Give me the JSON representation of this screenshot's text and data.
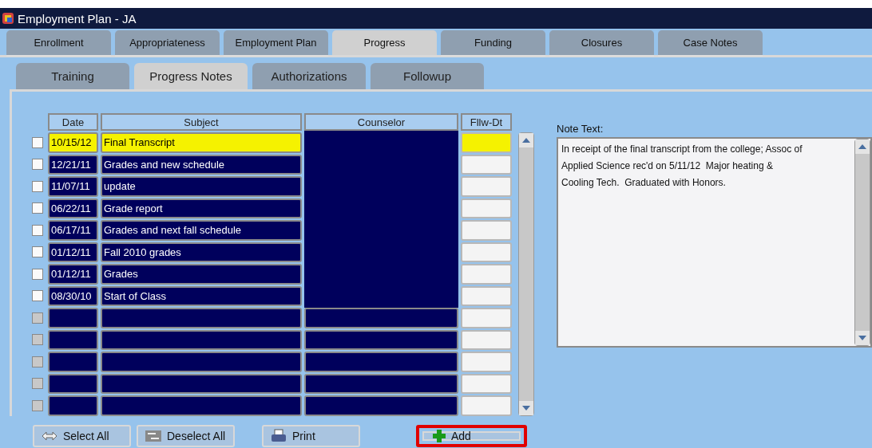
{
  "window": {
    "title": "Employment Plan - JA"
  },
  "tabs": [
    {
      "label": "Enrollment",
      "selected": false
    },
    {
      "label": "Appropriateness",
      "selected": false
    },
    {
      "label": "Employment Plan",
      "selected": false
    },
    {
      "label": "Progress",
      "selected": true
    },
    {
      "label": "Funding",
      "selected": false
    },
    {
      "label": "Closures",
      "selected": false
    },
    {
      "label": "Case Notes",
      "selected": false
    }
  ],
  "subtabs": [
    {
      "label": "Training",
      "selected": false
    },
    {
      "label": "Progress Notes",
      "selected": true
    },
    {
      "label": "Authorizations",
      "selected": false
    },
    {
      "label": "Followup",
      "selected": false
    }
  ],
  "table": {
    "columns": [
      "Date",
      "Subject",
      "Counselor",
      "Fllw-Dt"
    ],
    "rows": [
      {
        "kind": "note",
        "date": "10/15/12",
        "subject": "Final Transcript",
        "selected": true,
        "checked": false
      },
      {
        "kind": "note",
        "date": "12/21/11",
        "subject": "Grades and new schedule",
        "selected": false,
        "checked": false
      },
      {
        "kind": "note",
        "date": "11/07/11",
        "subject": "update",
        "selected": false,
        "checked": false
      },
      {
        "kind": "note",
        "date": "06/22/11",
        "subject": "Grade report",
        "selected": false,
        "checked": false
      },
      {
        "kind": "note",
        "date": "06/17/11",
        "subject": "Grades and next fall schedule",
        "selected": false,
        "checked": false
      },
      {
        "kind": "note",
        "date": "01/12/11",
        "subject": "Fall 2010 grades",
        "selected": false,
        "checked": false
      },
      {
        "kind": "note",
        "date": "01/12/11",
        "subject": "Grades",
        "selected": false,
        "checked": false
      },
      {
        "kind": "note",
        "date": "08/30/10",
        "subject": "Start of Class",
        "selected": false,
        "checked": false
      },
      {
        "kind": "empty",
        "disabled": true
      },
      {
        "kind": "empty",
        "disabled": true
      },
      {
        "kind": "empty",
        "disabled": true
      },
      {
        "kind": "empty",
        "disabled": true
      },
      {
        "kind": "empty",
        "disabled": true
      }
    ]
  },
  "note": {
    "label": "Note Text:",
    "value": "In receipt of the final transcript from the college; Assoc of Applied Science rec'd on 5/11/12  Major heating & Cooling Tech.  Graduated with Honors."
  },
  "buttons": [
    {
      "kind": "select",
      "label": "Select All",
      "highlighted": false
    },
    {
      "kind": "deselect",
      "label": "Deselect All",
      "highlighted": false
    },
    {
      "kind": "print",
      "label": "Print",
      "highlighted": false
    },
    {
      "kind": "add",
      "label": "Add",
      "highlighted": true
    }
  ]
}
